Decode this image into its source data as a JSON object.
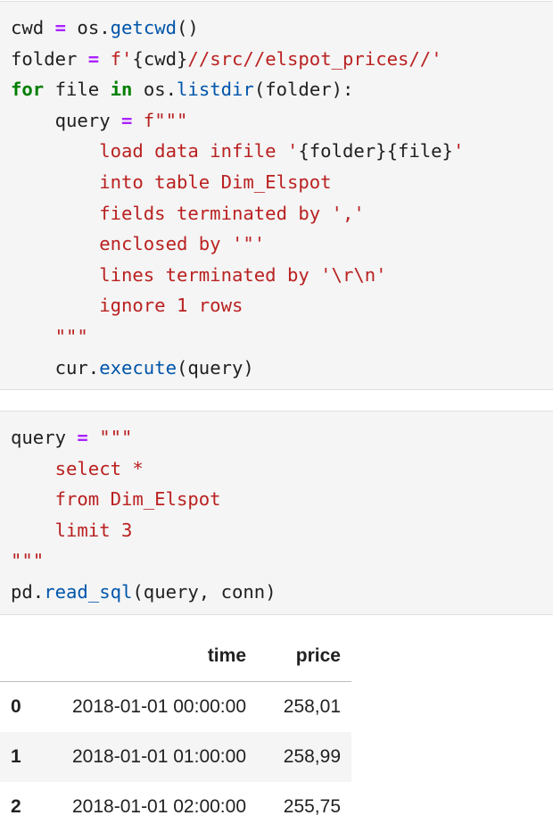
{
  "cells": [
    {
      "lines": [
        [
          {
            "t": "cwd "
          },
          {
            "t": "=",
            "c": "op"
          },
          {
            "t": " os."
          },
          {
            "t": "getcwd",
            "c": "fn"
          },
          {
            "t": "()"
          }
        ],
        [
          {
            "t": "folder "
          },
          {
            "t": "=",
            "c": "op"
          },
          {
            "t": " f",
            "c": "st"
          },
          {
            "t": "'",
            "c": "st"
          },
          {
            "t": "{cwd}"
          },
          {
            "t": "//src//elspot_prices//'",
            "c": "st"
          }
        ],
        [
          {
            "t": "for",
            "c": "kw"
          },
          {
            "t": " file "
          },
          {
            "t": "in",
            "c": "kw"
          },
          {
            "t": " os."
          },
          {
            "t": "listdir",
            "c": "fn"
          },
          {
            "t": "(folder):"
          }
        ],
        [
          {
            "t": "    query "
          },
          {
            "t": "=",
            "c": "op"
          },
          {
            "t": " f\"\"\"",
            "c": "st"
          }
        ],
        [
          {
            "t": "        load data infile '",
            "c": "st"
          },
          {
            "t": "{folder}{file}"
          },
          {
            "t": "'",
            "c": "st"
          }
        ],
        [
          {
            "t": "        into table Dim_Elspot",
            "c": "st"
          }
        ],
        [
          {
            "t": "        fields terminated by ','",
            "c": "st"
          }
        ],
        [
          {
            "t": "        enclosed by '\"'",
            "c": "st"
          }
        ],
        [
          {
            "t": "        lines terminated by '\\r\\n'",
            "c": "st"
          }
        ],
        [
          {
            "t": "        ignore 1 rows",
            "c": "st"
          }
        ],
        [
          {
            "t": "    \"\"\"",
            "c": "st"
          }
        ],
        [
          {
            "t": "    cur."
          },
          {
            "t": "execute",
            "c": "fn"
          },
          {
            "t": "(query)"
          }
        ]
      ]
    },
    {
      "lines": [
        [
          {
            "t": "query "
          },
          {
            "t": "=",
            "c": "op"
          },
          {
            "t": " \"\"\"",
            "c": "st"
          }
        ],
        [
          {
            "t": "    select *",
            "c": "st"
          }
        ],
        [
          {
            "t": "    from Dim_Elspot",
            "c": "st"
          }
        ],
        [
          {
            "t": "    limit 3",
            "c": "st"
          }
        ],
        [
          {
            "t": "\"\"\"",
            "c": "st"
          }
        ],
        [
          {
            "t": "pd."
          },
          {
            "t": "read_sql",
            "c": "fn"
          },
          {
            "t": "(query, conn)"
          }
        ]
      ]
    }
  ],
  "output": {
    "columns": [
      "time",
      "price"
    ],
    "rows": [
      {
        "index": "0",
        "time": "2018-01-01 00:00:00",
        "price": "258,01"
      },
      {
        "index": "1",
        "time": "2018-01-01 01:00:00",
        "price": "258,99"
      },
      {
        "index": "2",
        "time": "2018-01-01 02:00:00",
        "price": "255,75"
      }
    ]
  }
}
